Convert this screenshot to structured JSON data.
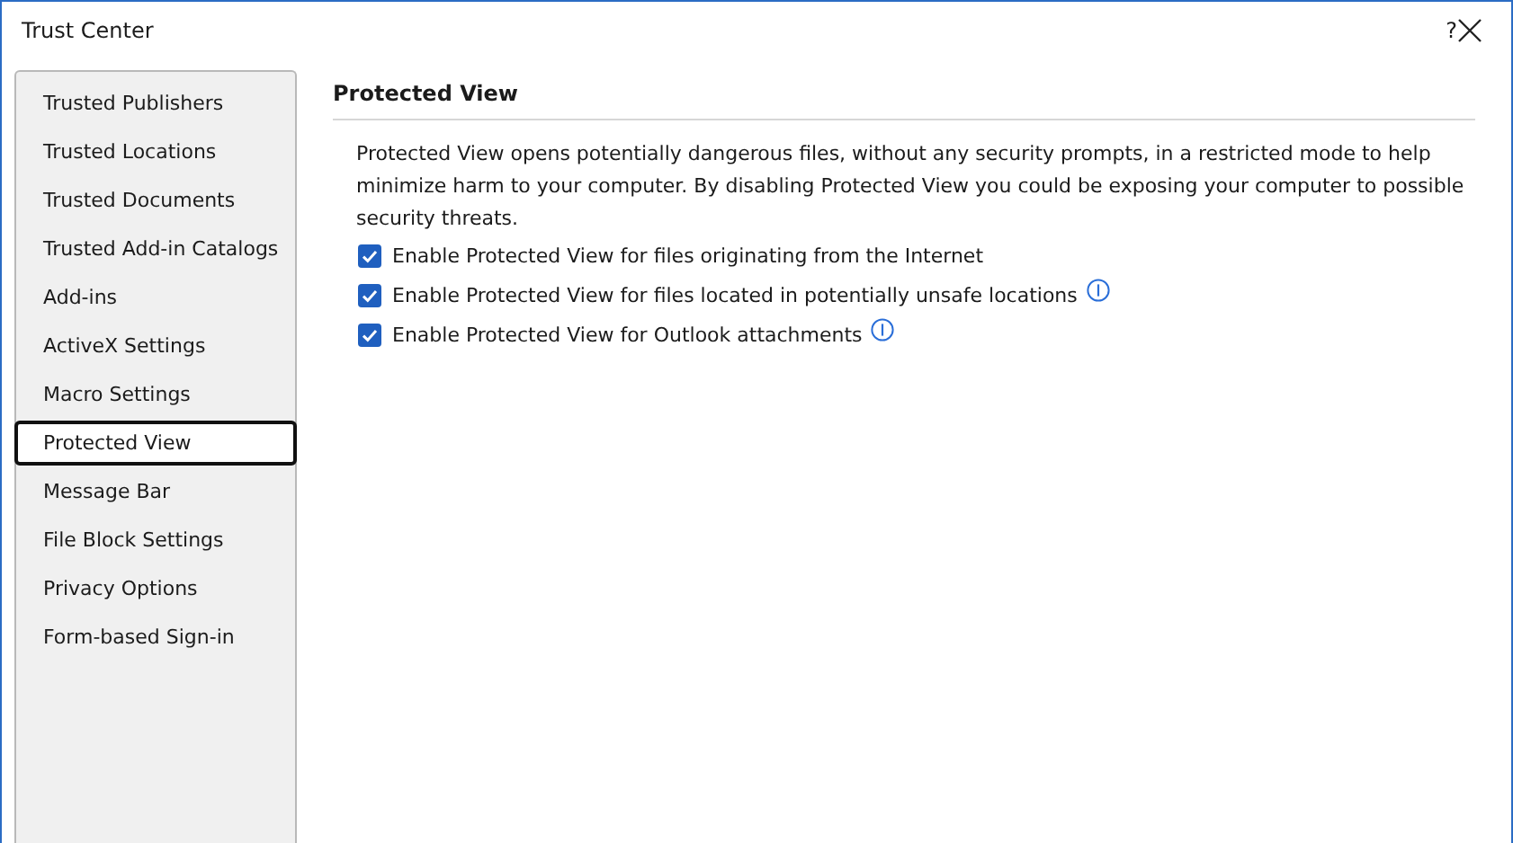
{
  "window": {
    "title": "Trust Center",
    "help": "?"
  },
  "sidebar": {
    "items": [
      {
        "label": "Trusted Publishers",
        "selected": false
      },
      {
        "label": "Trusted Locations",
        "selected": false
      },
      {
        "label": "Trusted Documents",
        "selected": false
      },
      {
        "label": "Trusted Add-in Catalogs",
        "selected": false
      },
      {
        "label": "Add-ins",
        "selected": false
      },
      {
        "label": "ActiveX Settings",
        "selected": false
      },
      {
        "label": "Macro Settings",
        "selected": false
      },
      {
        "label": "Protected View",
        "selected": true
      },
      {
        "label": "Message Bar",
        "selected": false
      },
      {
        "label": "File Block Settings",
        "selected": false
      },
      {
        "label": "Privacy Options",
        "selected": false
      },
      {
        "label": "Form-based Sign-in",
        "selected": false
      }
    ]
  },
  "section": {
    "heading": "Protected View",
    "description": "Protected View opens potentially dangerous files, without any security prompts, in a restricted mode to help minimize harm to your computer. By disabling Protected View you could be exposing your computer to possible security threats.",
    "options": [
      {
        "label": "Enable Protected View for files originating from the Internet",
        "checked": true,
        "info": false
      },
      {
        "label": "Enable Protected View for files located in potentially unsafe locations",
        "checked": true,
        "info": true
      },
      {
        "label": "Enable Protected View for Outlook attachments",
        "checked": true,
        "info": true
      }
    ]
  }
}
